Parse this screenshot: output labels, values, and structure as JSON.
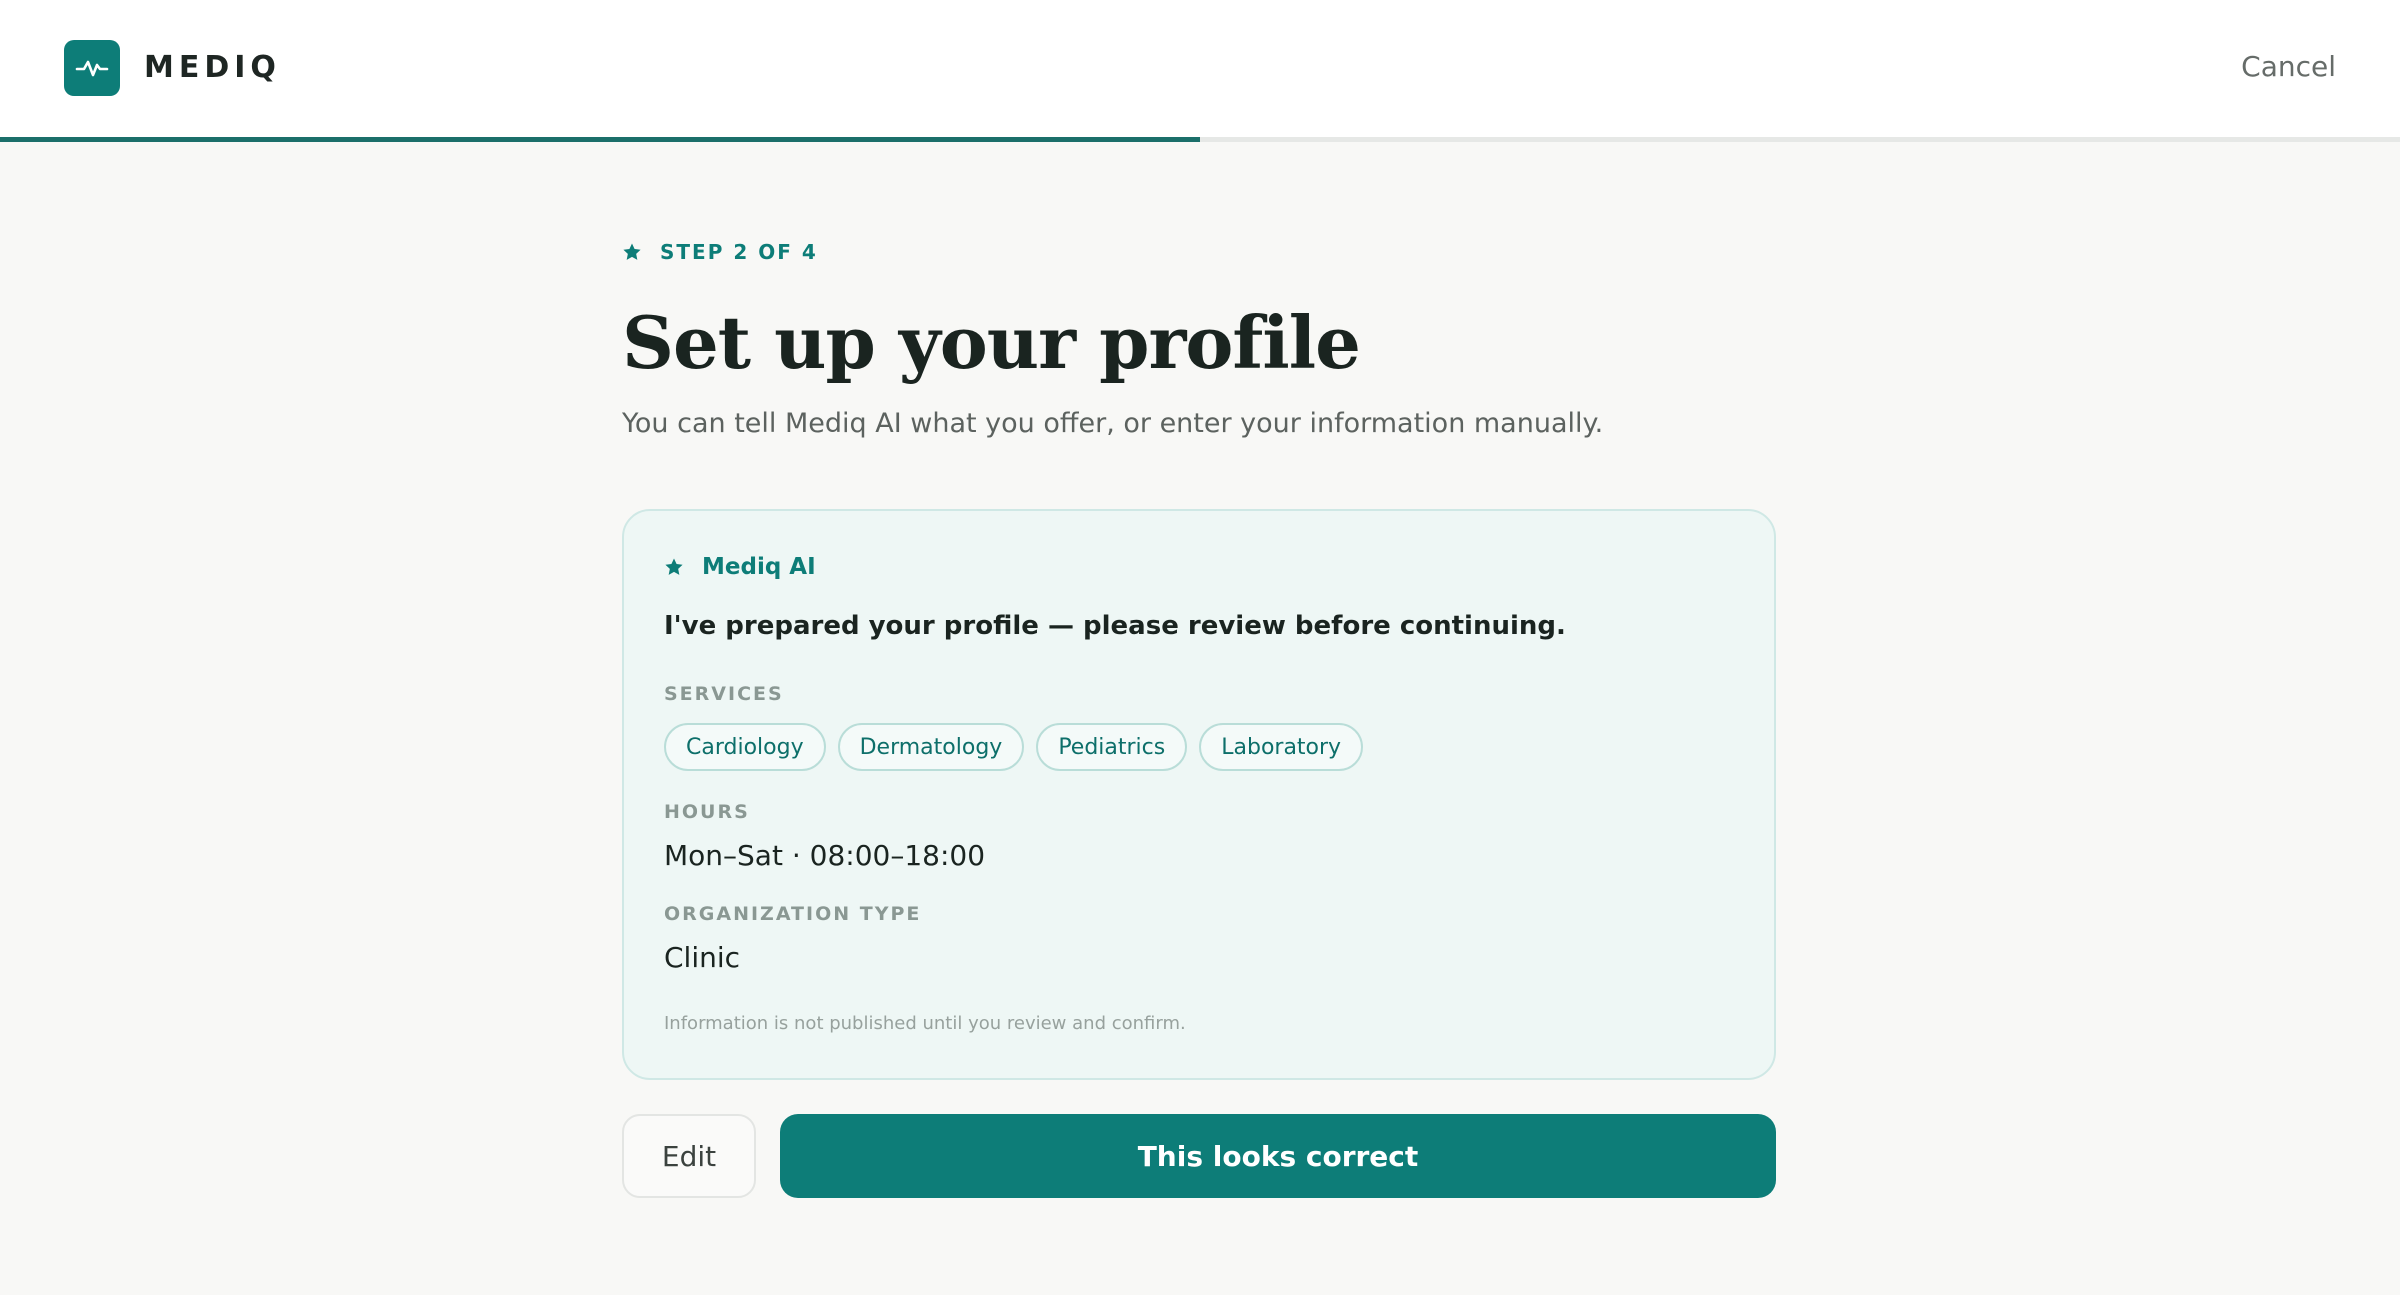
{
  "header": {
    "brand": "MEDIQ",
    "logo_icon": "pulse-icon",
    "cancel_label": "Cancel",
    "progress": {
      "current_step": 2,
      "total_steps": 4,
      "fraction": 0.5
    }
  },
  "step": {
    "label": "STEP 2 OF 4",
    "icon": "star-icon"
  },
  "title": "Set up your profile",
  "subtitle": "You can tell Mediq AI what you offer, or enter your information manually.",
  "card": {
    "assistant_name": "Mediq AI",
    "assistant_icon": "star-icon",
    "message": "I've prepared your profile — please review before continuing.",
    "services_label": "SERVICES",
    "services": [
      "Cardiology",
      "Dermatology",
      "Pediatrics",
      "Laboratory"
    ],
    "hours_label": "HOURS",
    "hours_value": "Mon–Sat · 08:00–18:00",
    "org_type_label": "ORGANIZATION TYPE",
    "org_type_value": "Clinic",
    "note": "Information is not published until you review and confirm."
  },
  "actions": {
    "edit_label": "Edit",
    "confirm_label": "This looks correct"
  },
  "colors": {
    "accent": "#0d7d78",
    "background": "#f8f8f6",
    "card_background": "#eef7f5",
    "card_border": "#cfe8e5"
  }
}
